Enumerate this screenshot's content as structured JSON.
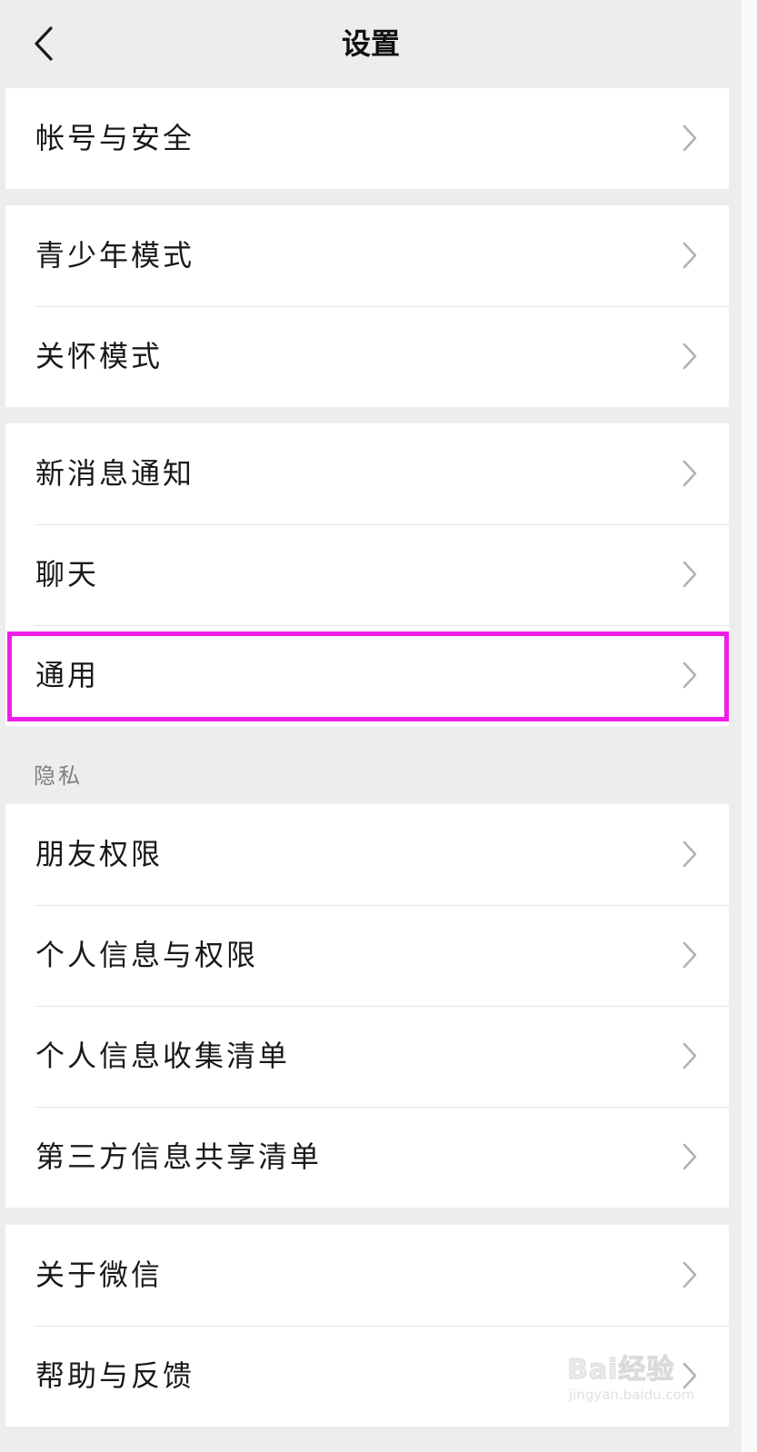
{
  "header": {
    "title": "设置",
    "back_icon": "chevron-left-icon"
  },
  "groups": {
    "account": {
      "items": [
        {
          "label": "帐号与安全"
        }
      ]
    },
    "modes": {
      "items": [
        {
          "label": "青少年模式"
        },
        {
          "label": "关怀模式"
        }
      ]
    },
    "general": {
      "items": [
        {
          "label": "新消息通知"
        },
        {
          "label": "聊天"
        },
        {
          "label": "通用"
        }
      ]
    },
    "privacy": {
      "section_label": "隐私",
      "items": [
        {
          "label": "朋友权限"
        },
        {
          "label": "个人信息与权限"
        },
        {
          "label": "个人信息收集清单"
        },
        {
          "label": "第三方信息共享清单"
        }
      ]
    },
    "about": {
      "items": [
        {
          "label": "关于微信"
        },
        {
          "label": "帮助与反馈"
        }
      ]
    }
  },
  "highlight": {
    "target": "通用",
    "color": "#ee1ee8"
  },
  "watermark": {
    "main": "Bai经验",
    "sub": "jingyan.baidu.com"
  },
  "colors": {
    "background": "#ededed",
    "row_background": "#ffffff",
    "text": "#191919",
    "section_text": "#7f7f7f",
    "chevron": "#b2b2b2",
    "divider": "#e6e6e6"
  }
}
